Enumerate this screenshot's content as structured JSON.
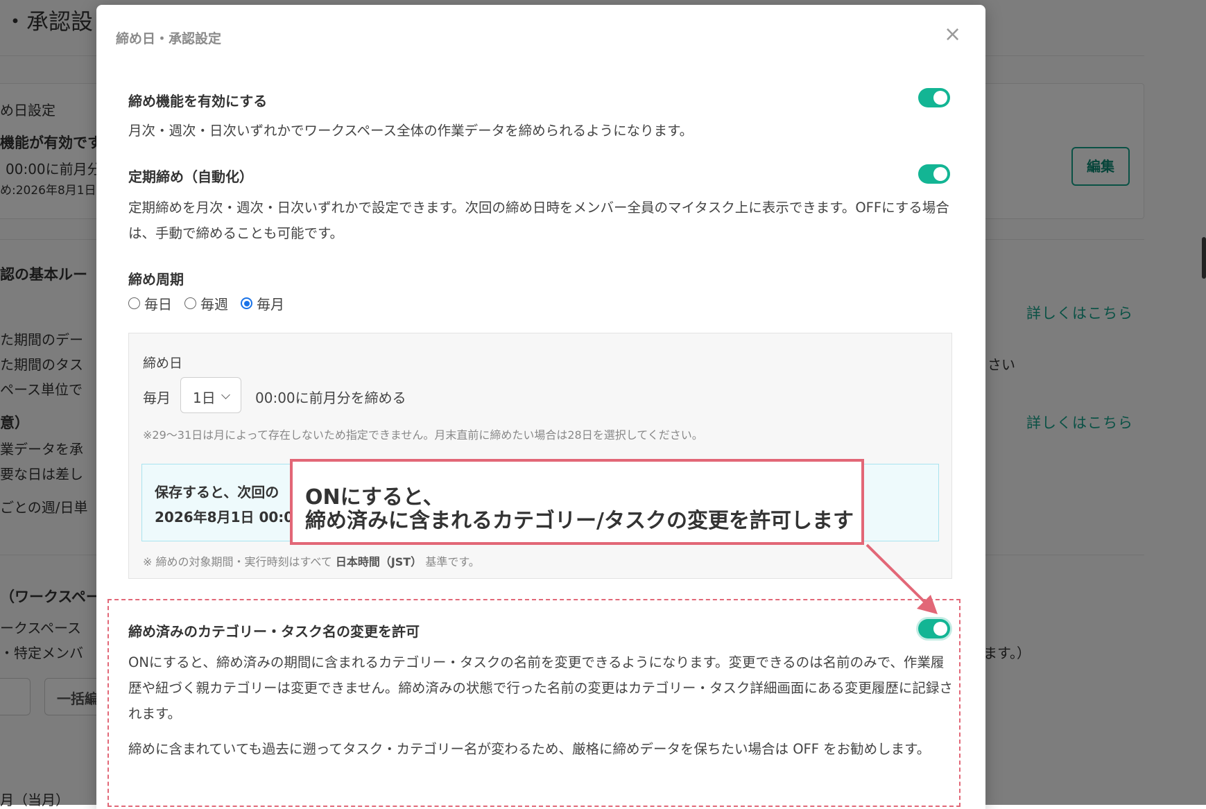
{
  "background": {
    "page_title": "・承認設",
    "closing_section": {
      "label": "め日設定",
      "enabled_text": "機能が有効です",
      "time_text": "00:00に前月分",
      "next_text": "め:2026年8月1日",
      "edit_button": "編集"
    },
    "approval_rules": {
      "heading": "認の基本ルー",
      "row1": "た期間のデー",
      "row2": "た期間のタス",
      "row3": "ペース単位で",
      "link1": "詳しくはこちら",
      "trailing": "さい",
      "optional_heading": "意）",
      "row4": "業データを承",
      "row5": "要な日は差し",
      "link2": "詳しくはこちら",
      "row6": "ごとの週/日単"
    },
    "workspace_section": {
      "heading": "（ワークスペー",
      "row1": "ークスペース",
      "row2": "・特定メンバ",
      "trailing": "ます。）",
      "bulk_button": "一括編",
      "month_label": "月（当月）"
    }
  },
  "modal": {
    "title": "締め日・承認設定",
    "close_icon": "×",
    "enable_closing": {
      "title": "締め機能を有効にする",
      "description": "月次・週次・日次いずれかでワークスペース全体の作業データを締められるようになります。",
      "enabled": true
    },
    "auto_closing": {
      "title": "定期締め（自動化）",
      "description": "定期締めを月次・週次・日次いずれかで設定できます。次回の締め日時をメンバー全員のマイタスク上に表示できます。OFFにする場合は、手動で締めることも可能です。",
      "enabled": true
    },
    "cycle": {
      "title": "締め周期",
      "options": [
        "毎日",
        "毎週",
        "毎月"
      ],
      "selected": "毎月"
    },
    "closing_day": {
      "label": "締め日",
      "prefix": "毎月",
      "selected_day": "1日",
      "suffix": "00:00に前月分を締める",
      "note": "※29〜31日は月によって存在しないため指定できません。月末直前に締めたい場合は28日を選択してください。",
      "notice_line1": "保存すると、次回の",
      "notice_line2": "2026年8月1日 00:0",
      "timezone_prefix": "※ 締めの対象期間・実行時刻はすべて",
      "timezone_bold": "日本時間（JST）",
      "timezone_suffix": "基準です。"
    },
    "allow_rename": {
      "title": "締め済みのカテゴリー・タスク名の変更を許可",
      "description": "ONにすると、締め済みの期間に含まれるカテゴリー・タスクの名前を変更できるようになります。変更できるのは名前のみで、作業履歴や紐づく親カテゴリーは変更できません。締め済みの状態で行った名前の変更はカテゴリー・タスク詳細画面にある変更履歴に記録されます。",
      "description2": "締めに含まれていても過去に遡ってタスク・カテゴリー名が変わるため、厳格に締めデータを保ちたい場合は OFF をお勧めします。",
      "enabled": true
    }
  },
  "annotation": {
    "line1": "ONにすると、",
    "line2": "締め済みに含まれるカテゴリー/タスクの変更を許可します"
  },
  "colors": {
    "accent": "#13b594",
    "annotation": "#e26777",
    "radio": "#1a73e8",
    "notice_bg": "#eefafc"
  }
}
